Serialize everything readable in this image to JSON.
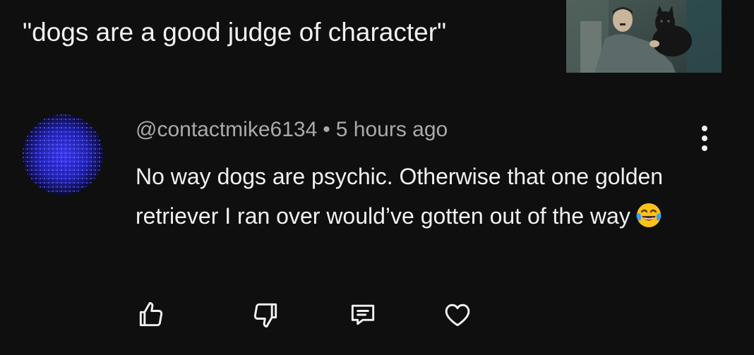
{
  "post": {
    "title": "\"dogs are a good judge of character\""
  },
  "comment": {
    "author": "@contactmike6134",
    "separator": "•",
    "time": "5 hours ago",
    "text": "No way dogs are psychic. Otherwise that one golden retriever I ran over would’ve gotten out of the way",
    "emoji": "face-with-tears-of-joy-icon"
  },
  "actions": {
    "icons": [
      "thumbs-up-icon",
      "thumbs-down-icon",
      "reply-icon",
      "heart-icon"
    ]
  },
  "colors": {
    "background": "#0f0f0f",
    "text_primary": "#f1f1f1",
    "text_secondary": "#aaaaaa",
    "avatar_blue": "#2a2ad8"
  }
}
